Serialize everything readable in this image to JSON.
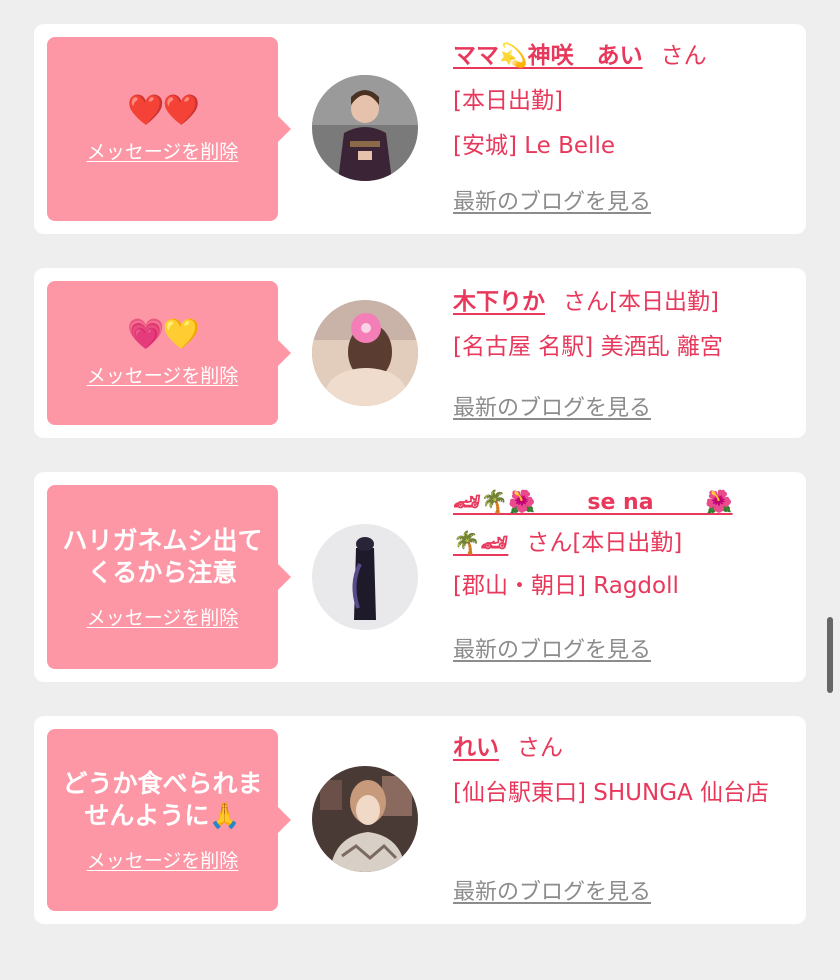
{
  "cards": [
    {
      "message": "❤️❤️",
      "delete_label": "メッセージを削除",
      "name": "ママ💫神咲　あい",
      "san": "さん",
      "status": "[本日出勤]",
      "shop": "[安城] Le Belle",
      "blog_label": "最新のブログを見る"
    },
    {
      "message": "💗💛",
      "delete_label": "メッセージを削除",
      "name": "木下りか",
      "san": "さん",
      "status": "[本日出勤]",
      "shop": "[名古屋 名駅] 美酒乱 離宮",
      "blog_label": "最新のブログを見る"
    },
    {
      "message": "ハリガネムシ出てくるから注意",
      "delete_label": "メッセージを削除",
      "name_line1": "🏎🌴🌺　　 se na 　　🌺",
      "name_line2": "🌴🏎",
      "san": "さん",
      "status": "[本日出勤]",
      "shop": "[郡山・朝日] Ragdoll",
      "blog_label": "最新のブログを見る"
    },
    {
      "message": "どうか食べられませんように🙏",
      "delete_label": "メッセージを削除",
      "name": "れい",
      "san": "さん",
      "shop": "[仙台駅東口] SHUNGA 仙台店",
      "blog_label": "最新のブログを見る"
    }
  ],
  "colors": {
    "accent": "#e8395c",
    "bubble": "#fd97a6",
    "link_gray": "#8c8c8c",
    "background": "#eeeeee"
  }
}
